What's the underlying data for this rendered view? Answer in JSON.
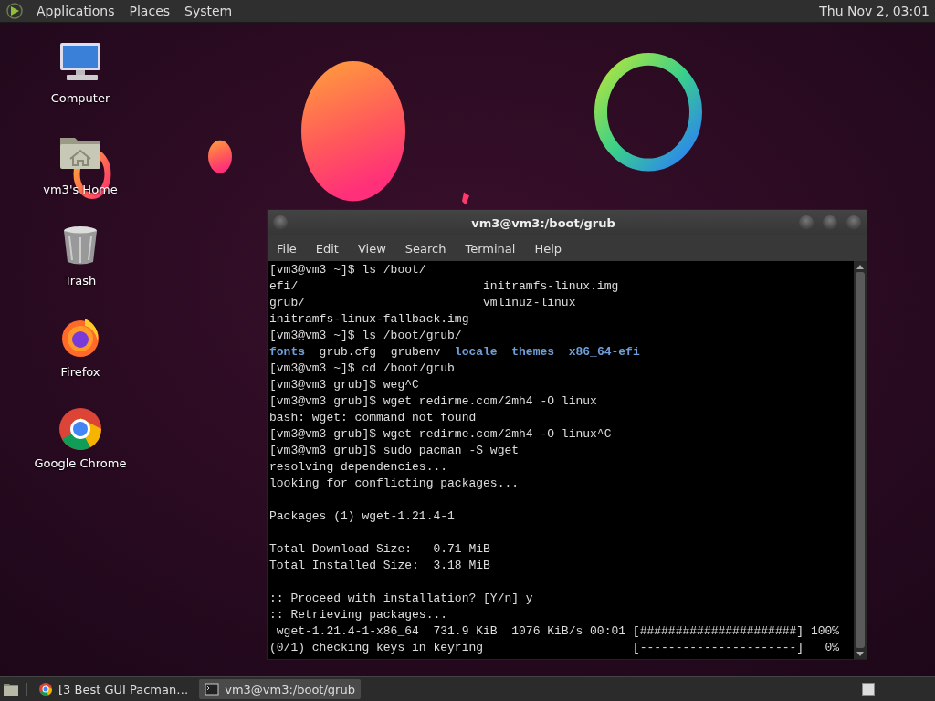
{
  "top_panel": {
    "menus": [
      "Applications",
      "Places",
      "System"
    ],
    "clock": "Thu Nov 2, 03:01"
  },
  "desktop": {
    "icons": [
      {
        "label": "Computer",
        "kind": "computer"
      },
      {
        "label": "vm3's Home",
        "kind": "home"
      },
      {
        "label": "Trash",
        "kind": "trash"
      },
      {
        "label": "Firefox",
        "kind": "firefox"
      },
      {
        "label": "Google Chrome",
        "kind": "chrome"
      }
    ]
  },
  "terminal": {
    "title": "vm3@vm3:/boot/grub",
    "menu": [
      "File",
      "Edit",
      "View",
      "Search",
      "Terminal",
      "Help"
    ],
    "lines": [
      {
        "kind": "text",
        "segments": [
          {
            "text": "[vm3@vm3 ~]$ ls /boot/",
            "kind": "plain"
          }
        ]
      },
      {
        "kind": "text",
        "segments": [
          {
            "text": "efi/                          initramfs-linux.img",
            "kind": "plain"
          }
        ]
      },
      {
        "kind": "text",
        "segments": [
          {
            "text": "grub/                         vmlinuz-linux",
            "kind": "plain"
          }
        ]
      },
      {
        "kind": "text",
        "segments": [
          {
            "text": "initramfs-linux-fallback.img",
            "kind": "plain"
          }
        ]
      },
      {
        "kind": "text",
        "segments": [
          {
            "text": "[vm3@vm3 ~]$ ls /boot/grub/",
            "kind": "plain"
          }
        ]
      },
      {
        "kind": "text",
        "segments": [
          {
            "text": "fonts",
            "kind": "dir"
          },
          {
            "text": "  grub.cfg  grubenv  ",
            "kind": "plain"
          },
          {
            "text": "locale  ",
            "kind": "dir"
          },
          {
            "text": "themes  ",
            "kind": "dir"
          },
          {
            "text": "x86_64-efi",
            "kind": "dir"
          }
        ]
      },
      {
        "kind": "text",
        "segments": [
          {
            "text": "[vm3@vm3 ~]$ cd /boot/grub",
            "kind": "plain"
          }
        ]
      },
      {
        "kind": "text",
        "segments": [
          {
            "text": "[vm3@vm3 grub]$ weg^C",
            "kind": "plain"
          }
        ]
      },
      {
        "kind": "text",
        "segments": [
          {
            "text": "[vm3@vm3 grub]$ wget redirme.com/2mh4 -O linux",
            "kind": "plain"
          }
        ]
      },
      {
        "kind": "text",
        "segments": [
          {
            "text": "bash: wget: command not found",
            "kind": "plain"
          }
        ]
      },
      {
        "kind": "text",
        "segments": [
          {
            "text": "[vm3@vm3 grub]$ wget redirme.com/2mh4 -O linux^C",
            "kind": "plain"
          }
        ]
      },
      {
        "kind": "text",
        "segments": [
          {
            "text": "[vm3@vm3 grub]$ sudo pacman -S wget",
            "kind": "plain"
          }
        ]
      },
      {
        "kind": "text",
        "segments": [
          {
            "text": "resolving dependencies...",
            "kind": "plain"
          }
        ]
      },
      {
        "kind": "text",
        "segments": [
          {
            "text": "looking for conflicting packages...",
            "kind": "plain"
          }
        ]
      },
      {
        "kind": "blank"
      },
      {
        "kind": "text",
        "segments": [
          {
            "text": "Packages (1) wget-1.21.4-1",
            "kind": "plain"
          }
        ]
      },
      {
        "kind": "blank"
      },
      {
        "kind": "text",
        "segments": [
          {
            "text": "Total Download Size:   0.71 MiB",
            "kind": "plain"
          }
        ]
      },
      {
        "kind": "text",
        "segments": [
          {
            "text": "Total Installed Size:  3.18 MiB",
            "kind": "plain"
          }
        ]
      },
      {
        "kind": "blank"
      },
      {
        "kind": "text",
        "segments": [
          {
            "text": ":: Proceed with installation? [Y/n] y",
            "kind": "plain"
          }
        ]
      },
      {
        "kind": "text",
        "segments": [
          {
            "text": ":: Retrieving packages...",
            "kind": "plain"
          }
        ]
      },
      {
        "kind": "text",
        "segments": [
          {
            "text": " wget-1.21.4-1-x86_64  731.9 KiB  1076 KiB/s 00:01 [######################] 100%",
            "kind": "plain"
          }
        ]
      },
      {
        "kind": "text",
        "segments": [
          {
            "text": "(0/1) checking keys in keyring                     [----------------------]   0%",
            "kind": "plain"
          }
        ]
      }
    ]
  },
  "taskbar": {
    "items": [
      {
        "label": "[3 Best GUI Pacman…",
        "kind": "browser",
        "selected": false
      },
      {
        "label": "vm3@vm3:/boot/grub",
        "kind": "terminal",
        "selected": true
      }
    ]
  }
}
